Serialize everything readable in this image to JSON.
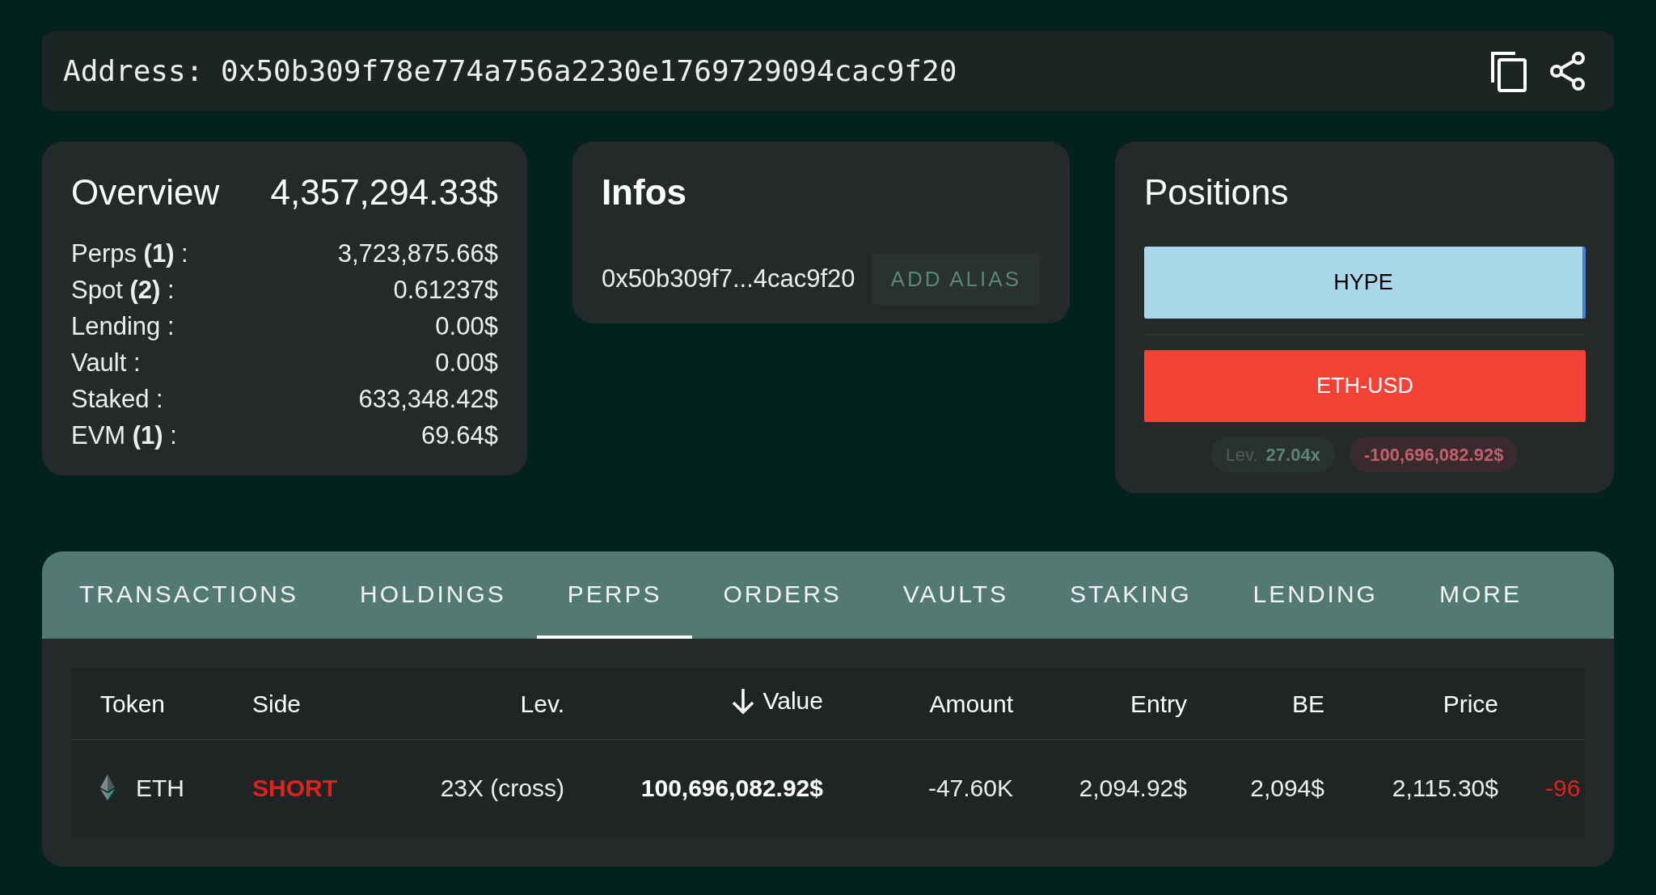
{
  "address_bar": {
    "text": "Address: 0x50b309f78e774a756a2230e1769729094cac9f20"
  },
  "overview": {
    "title": "Overview",
    "total": "4,357,294.33$",
    "rows": [
      {
        "label": "Perps **(1)** :",
        "value": "3,723,875.66$"
      },
      {
        "label": "Spot **(2)** :",
        "value": "0.61237$"
      },
      {
        "label": "Lending :",
        "value": "0.00$"
      },
      {
        "label": "Vault :",
        "value": "0.00$"
      },
      {
        "label": "Staked :",
        "value": "633,348.42$"
      },
      {
        "label": "EVM **(1)** :",
        "value": "69.64$"
      }
    ]
  },
  "infos": {
    "title": "Infos",
    "address": "0x50b309f7...4cac9f20",
    "button": "ADD ALIAS"
  },
  "positions": {
    "title": "Positions",
    "items": [
      {
        "label": "HYPE",
        "kind": "long"
      },
      {
        "label": "ETH-USD",
        "kind": "short"
      }
    ],
    "leverage_label": "Lev.",
    "leverage": "27.04x",
    "pnl": "-100,696,082.92$"
  },
  "tabs": [
    {
      "label": "TRANSACTIONS",
      "selected": false
    },
    {
      "label": "HOLDINGS",
      "selected": false
    },
    {
      "label": "PERPS",
      "selected": true
    },
    {
      "label": "ORDERS",
      "selected": false
    },
    {
      "label": "VAULTS",
      "selected": false
    },
    {
      "label": "STAKING",
      "selected": false
    },
    {
      "label": "LENDING",
      "selected": false
    },
    {
      "label": "MORE",
      "selected": false
    }
  ],
  "table": {
    "columns": [
      {
        "label": "Token",
        "sorted": false
      },
      {
        "label": "Side",
        "sorted": false
      },
      {
        "label": "Lev.",
        "sorted": false
      },
      {
        "label": "Value",
        "sorted": true
      },
      {
        "label": "Amount",
        "sorted": false
      },
      {
        "label": "Entry",
        "sorted": false
      },
      {
        "label": "BE",
        "sorted": false
      },
      {
        "label": "Price",
        "sorted": false
      }
    ],
    "rows": [
      {
        "token": "ETH",
        "side": "SHORT",
        "lev": "23X (cross)",
        "value": "100,696,082.92$",
        "amount": "-47.60K",
        "entry": "2,094.92$",
        "be": "2,094$",
        "price": "2,115.30$",
        "column_9": "-96"
      }
    ]
  }
}
